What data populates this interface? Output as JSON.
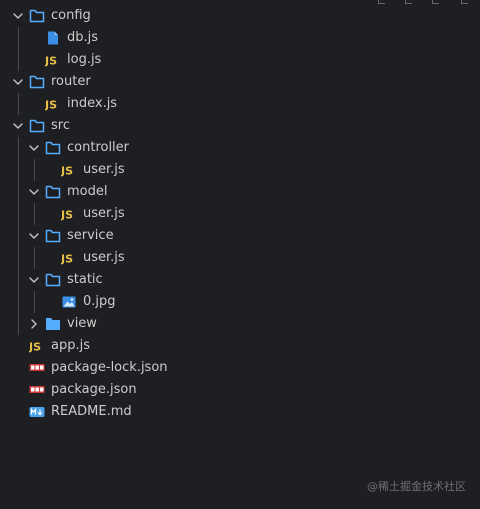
{
  "explorer": {
    "items": [
      {
        "id": "config",
        "label": "config",
        "type": "folder",
        "depth": 0,
        "expanded": true
      },
      {
        "id": "config-db",
        "label": "db.js",
        "type": "file-js-blue",
        "depth": 1
      },
      {
        "id": "config-log",
        "label": "log.js",
        "type": "file-js",
        "depth": 1
      },
      {
        "id": "router",
        "label": "router",
        "type": "folder",
        "depth": 0,
        "expanded": true
      },
      {
        "id": "router-index",
        "label": "index.js",
        "type": "file-js",
        "depth": 1
      },
      {
        "id": "src",
        "label": "src",
        "type": "folder",
        "depth": 0,
        "expanded": true
      },
      {
        "id": "src-controller",
        "label": "controller",
        "type": "folder",
        "depth": 1,
        "expanded": true
      },
      {
        "id": "src-controller-user",
        "label": "user.js",
        "type": "file-js",
        "depth": 2
      },
      {
        "id": "src-model",
        "label": "model",
        "type": "folder",
        "depth": 1,
        "expanded": true
      },
      {
        "id": "src-model-user",
        "label": "user.js",
        "type": "file-js",
        "depth": 2
      },
      {
        "id": "src-service",
        "label": "service",
        "type": "folder",
        "depth": 1,
        "expanded": true
      },
      {
        "id": "src-service-user",
        "label": "user.js",
        "type": "file-js",
        "depth": 2
      },
      {
        "id": "src-static",
        "label": "static",
        "type": "folder",
        "depth": 1,
        "expanded": true
      },
      {
        "id": "src-static-0jpg",
        "label": "0.jpg",
        "type": "file-image",
        "depth": 2
      },
      {
        "id": "src-view",
        "label": "view",
        "type": "folder-filled",
        "depth": 1,
        "expanded": false
      },
      {
        "id": "app",
        "label": "app.js",
        "type": "file-js",
        "depth": 0
      },
      {
        "id": "package-lock",
        "label": "package-lock.json",
        "type": "file-npm",
        "depth": 0
      },
      {
        "id": "package",
        "label": "package.json",
        "type": "file-npm",
        "depth": 0
      },
      {
        "id": "readme",
        "label": "README.md",
        "type": "file-md",
        "depth": 0
      }
    ]
  },
  "watermark": "@稀土掘金技术社区",
  "icons": {
    "chevron_expanded": "chevron-down-icon",
    "chevron_collapsed": "chevron-right-icon",
    "folder": "folder-outline-icon",
    "folder_filled": "folder-filled-icon",
    "js": "javascript-file-icon",
    "js_blue": "javascript-file-icon-blue",
    "image": "image-file-icon",
    "npm": "npm-package-icon",
    "markdown": "markdown-file-icon"
  },
  "colors": {
    "background": "#1e1f22",
    "text": "#cccccc",
    "folder": "#54aeff",
    "js_badge": "#e8c046",
    "js_blue": "#3a8ee6",
    "npm": "#cb3837",
    "markdown": "#4aa3e8",
    "image": "#3a8ee6",
    "watermark": "#6f6f6f"
  }
}
